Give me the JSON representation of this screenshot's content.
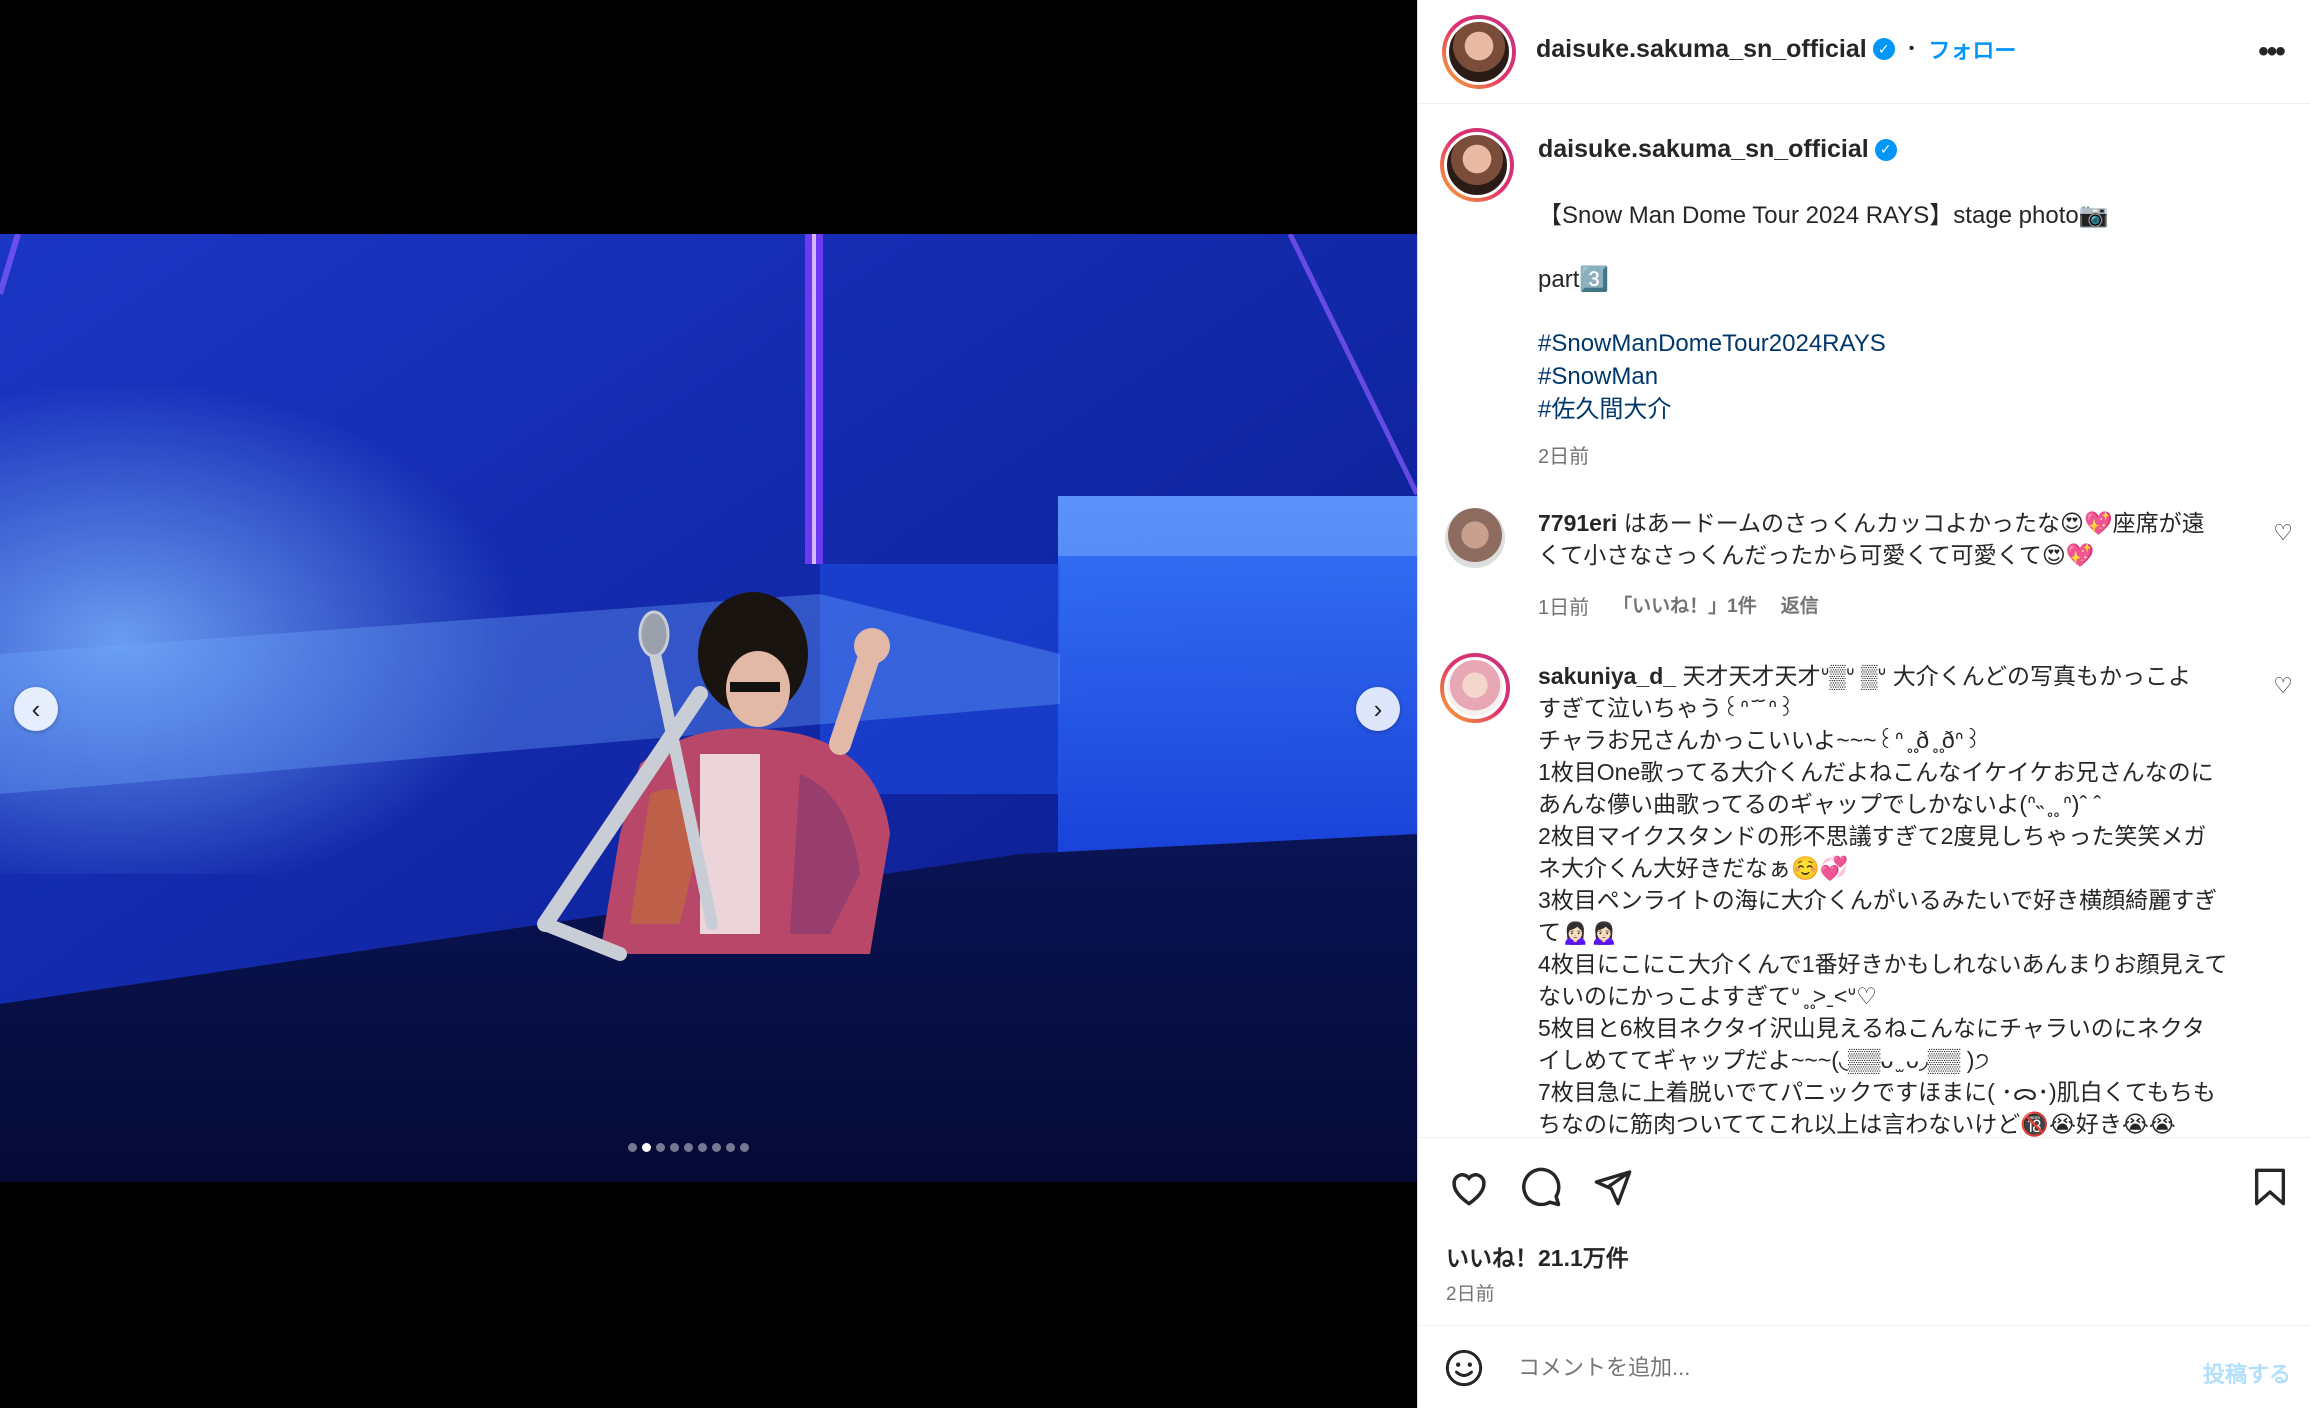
{
  "header": {
    "username": "daisuke.sakuma_sn_official",
    "separator": "•",
    "follow_label": "フォロー",
    "more_icon": "more-horizontal-icon"
  },
  "caption": {
    "username": "daisuke.sakuma_sn_official",
    "line1": "【Snow Man Dome Tour 2024 RAYS】stage photo📷",
    "line2": "part3️⃣",
    "hashtags": [
      "#SnowManDomeTour2024RAYS",
      "#SnowMan",
      "#佐久間大介"
    ],
    "time": "2日前"
  },
  "comments": [
    {
      "username": "7791eri",
      "text_line1": "はあードームのさっくんカッコよかったな😍💖座席が遠",
      "text_line2": "くて小さなさっくんだったから可愛くて可愛くて😍💖",
      "time": "1日前",
      "likes": "「いいね！」1件",
      "reply": "返信"
    },
    {
      "username": "sakuniya_d_",
      "text_line1": "天才天才天才ᐡ▒ᐡ ▒ᐡ 大介くんどの写真もかっこよ",
      "lines": [
        "すぎて泣いちゃう꒰ᐢ ᷄ ᷄ ᐢ꒱",
        "チャラお兄さんかっこいいよ~~~꒰ᐢ ̥ ̥ð ̥ ̥ðᐢ꒱",
        "1枚目One歌ってる大介くんだよねこんなイケイケお兄さんなのに",
        "あんな儚い曲歌ってるのギャップでしかないよ(ᐢ˵ ̥ ̥ ᐢ)ˆ ˆ",
        "2枚目マイクスタンドの形不思議すぎて2度見しちゃった笑笑メガ",
        "ネ大介くん大好きだなぁ☺️💞",
        "3枚目ペンライトの海に大介くんがいるみたいで好き横顔綺麗すぎ",
        "て🙍🏻‍♀️🙍🏻‍♀️",
        "4枚目にこにこ大介くんで1番好きかもしれないあんまりお顔見えて",
        "ないのにかっこよすぎてᐡ ̥ ̥>ˍ<ᐡ♡",
        "5枚目と6枚目ネクタイ沢山見えるねこんなにチャラいのにネクタ",
        "イしめててギャップだよ~~~(◟▒▒ᴗ ̫ ᴗ◞▒▒ )੭",
        "7枚目急に上着脱いでてパニックですほまに( ･ᯅ･)肌白くてもちも",
        "ちなのに筋肉ついててこれ以上は言わないけど🔞😭好き😭😭"
      ]
    }
  ],
  "actions": {
    "like_icon": "heart-icon",
    "comment_icon": "comment-icon",
    "share_icon": "send-icon",
    "save_icon": "bookmark-icon"
  },
  "likes_summary": "いいね！21.1万件",
  "post_time": "2日前",
  "comment_box": {
    "emoji_icon": "smiley-icon",
    "placeholder": "コメントを追加...",
    "submit_label": "投稿する"
  },
  "carousel": {
    "total_slides": 9,
    "active_index": 1,
    "prev_icon": "chevron-left-icon",
    "next_icon": "chevron-right-icon"
  },
  "colors": {
    "accent_blue": "#0095f6",
    "hashtag_blue": "#00376b",
    "text_primary": "#262626",
    "text_muted": "#737373",
    "border": "#dbdbdb"
  }
}
